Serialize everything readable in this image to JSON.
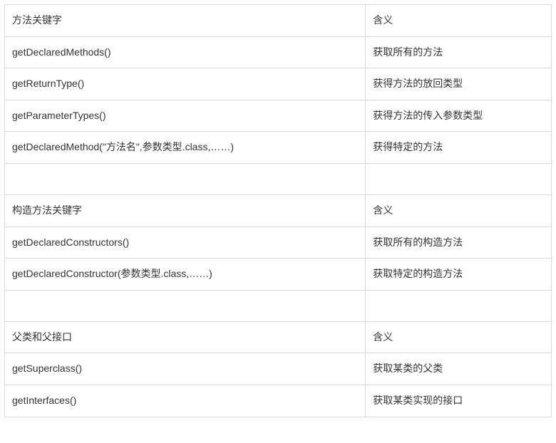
{
  "rows": [
    {
      "left": "方法关键字",
      "right": "含义"
    },
    {
      "left": "getDeclaredMethods()",
      "right": "获取所有的方法"
    },
    {
      "left": "getReturnType()",
      "right": "获得方法的放回类型"
    },
    {
      "left": "getParameterTypes()",
      "right": "获得方法的传入参数类型"
    },
    {
      "left": "getDeclaredMethod(\"方法名\",参数类型.class,……)",
      "right": "获得特定的方法"
    },
    {
      "left": "",
      "right": ""
    },
    {
      "left": "构造方法关键字",
      "right": "含义"
    },
    {
      "left": "getDeclaredConstructors()",
      "right": "获取所有的构造方法"
    },
    {
      "left": "getDeclaredConstructor(参数类型.class,……)",
      "right": "获取特定的构造方法"
    },
    {
      "left": "",
      "right": ""
    },
    {
      "left": "父类和父接口",
      "right": "含义"
    },
    {
      "left": "getSuperclass()",
      "right": "获取某类的父类"
    },
    {
      "left": "getInterfaces()",
      "right": "获取某类实现的接口"
    }
  ]
}
